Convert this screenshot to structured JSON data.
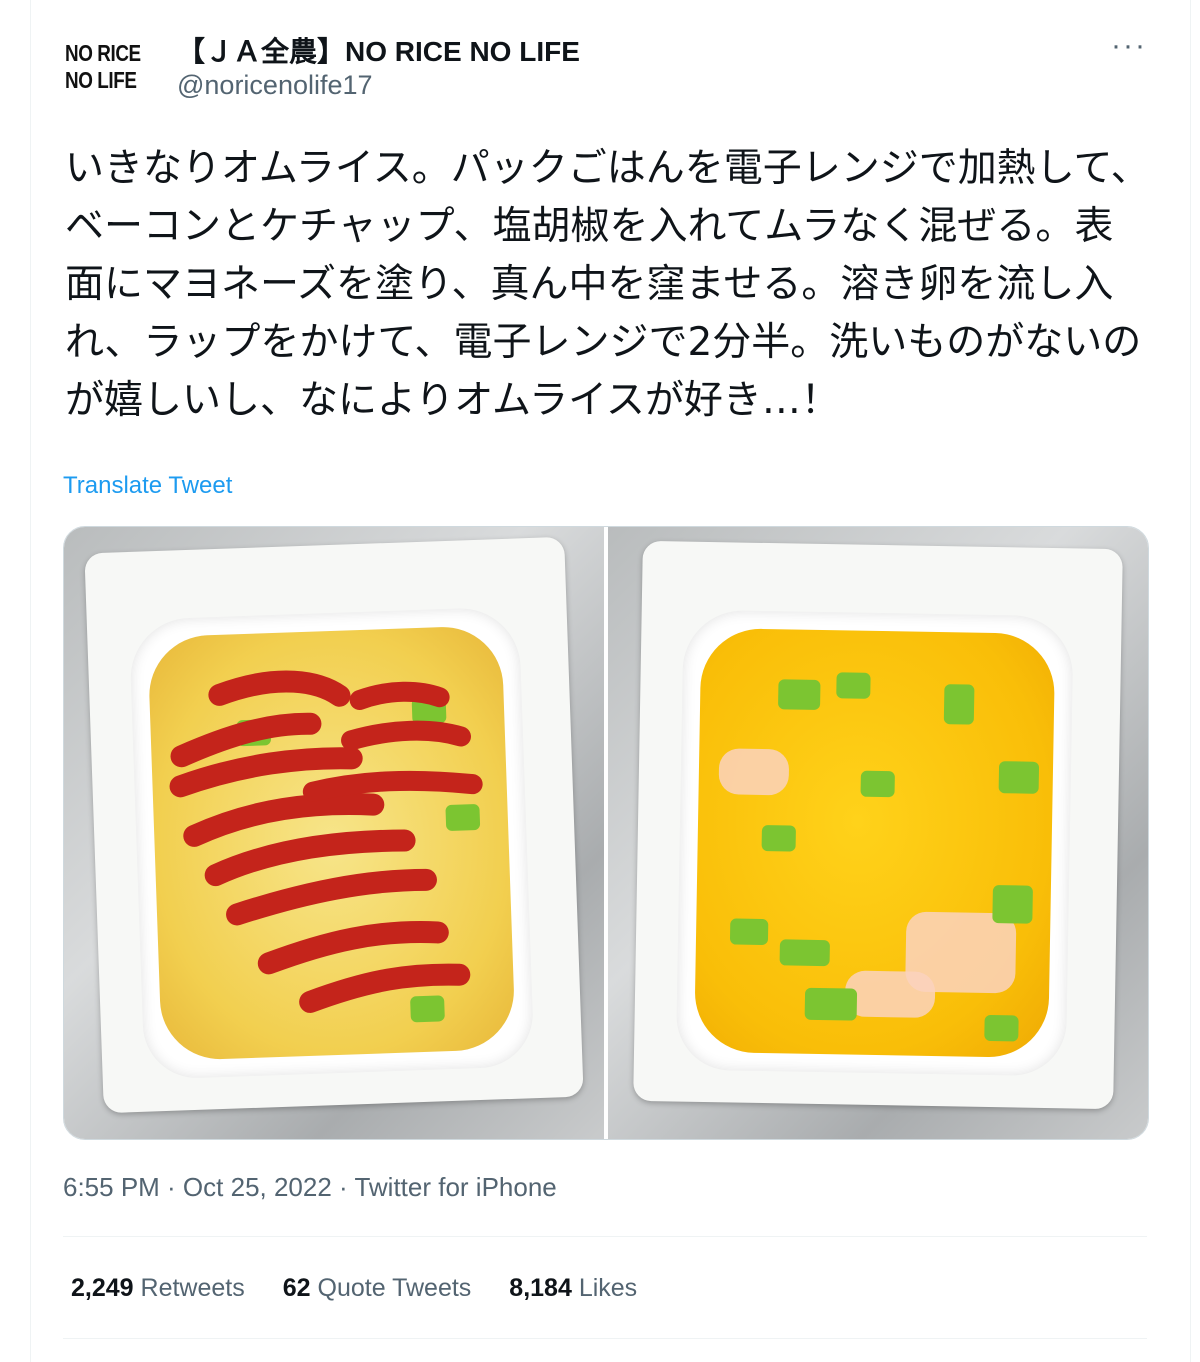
{
  "tweet": {
    "logo_line1": "NO RICE",
    "logo_line2": "NO LIFE",
    "display_name": "【ＪＡ全農】NO RICE NO LIFE",
    "handle": "@noricenolife17",
    "more_icon": "···",
    "text": "いきなりオムライス。パックごはんを電子レンジで加熱して、ベーコンとケチャップ、塩胡椒を入れてムラなく混ぜる。表面にマヨネーズを塗り、真ん中を窪ませる。溶き卵を流し入れ、ラップをかけて、電子レンジで2分半。洗いものがないのが嬉しいし、なによりオムライスが好き…！",
    "translate_label": "Translate Tweet",
    "timestamp": "6:55 PM · Oct 25, 2022 · Twitter for iPhone"
  },
  "stats": {
    "retweets_count": "2,249",
    "retweets_label": "Retweets",
    "quotes_count": "62",
    "quotes_label": "Quote Tweets",
    "likes_count": "8,184",
    "likes_label": "Likes"
  },
  "colors": {
    "link": "#1d9bf0",
    "secondary_text": "#536471",
    "primary_text": "#0f1419"
  }
}
